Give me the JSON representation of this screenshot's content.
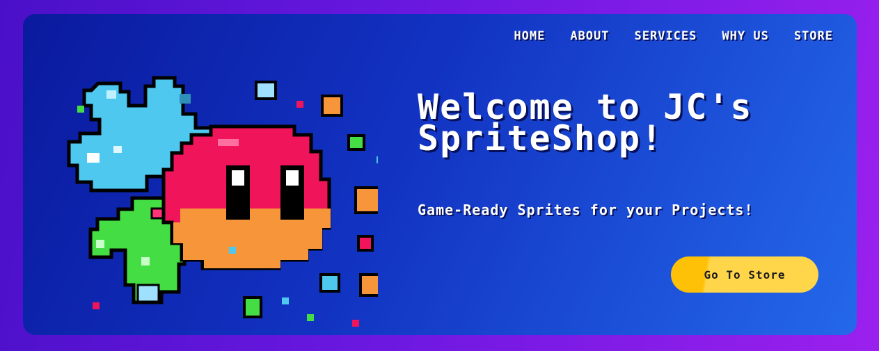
{
  "nav": {
    "items": [
      {
        "label": "HOME"
      },
      {
        "label": "ABOUT"
      },
      {
        "label": "SERVICES"
      },
      {
        "label": "WHY US"
      },
      {
        "label": "STORE"
      }
    ]
  },
  "hero": {
    "title": "Welcome to JC's SpriteShop!",
    "subtitle": "Game-Ready Sprites for your Projects!",
    "cta_label": "Go To Store",
    "illustration": "pixel-art-slime-creatures"
  },
  "colors": {
    "background": "#6a18e0",
    "hero_start": "#0a1a9e",
    "hero_end": "#2468ea",
    "button": "#ffc107",
    "slime_pink": "#f0145a",
    "slime_blue": "#4fc8f0",
    "slime_green": "#44dd44"
  }
}
